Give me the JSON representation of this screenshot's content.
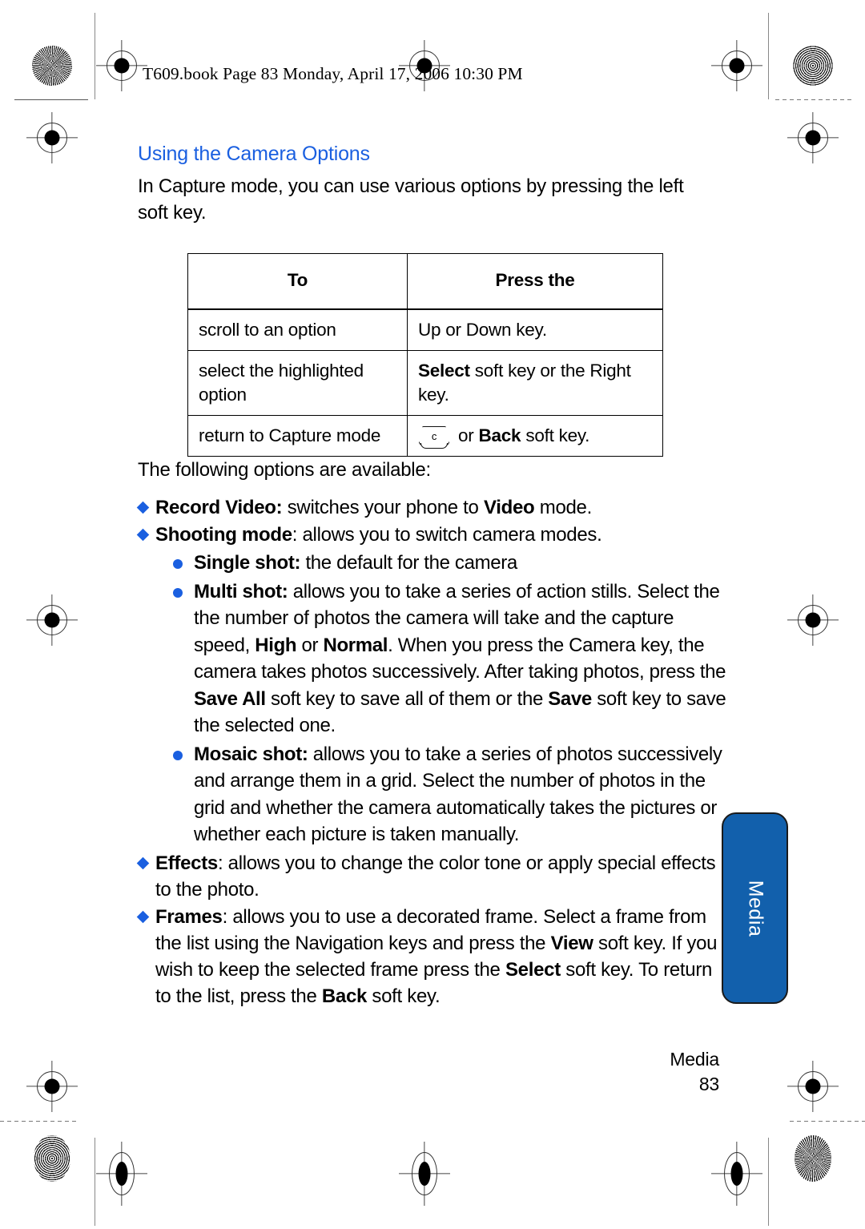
{
  "document": {
    "header_line": "T609.book  Page 83  Monday, April 17, 2006  10:30 PM",
    "section_title": "Using the Camera Options",
    "intro_paragraph": "In Capture mode, you can use various options by pressing the left soft key.",
    "after_table_paragraph": "The following options are available:"
  },
  "table": {
    "headers": [
      "To",
      "Press the"
    ],
    "rows": [
      {
        "to": "scroll to an option",
        "press_plain": "Up or Down key."
      },
      {
        "to": "select the highlighted option",
        "press_bold": "Select",
        "press_rest": " soft key or the Right key."
      },
      {
        "to": "return to Capture mode",
        "key_icon_label": "c",
        "press_mid": " or ",
        "press_bold": "Back",
        "press_rest": " soft key."
      }
    ]
  },
  "options": [
    {
      "bold": "Record Video:",
      "rest_a": " switches your phone to ",
      "bold_b": "Video",
      "rest_b": " mode."
    },
    {
      "bold": "Shooting mode",
      "rest_a": ": allows you to switch camera modes.",
      "sub": [
        {
          "bold": "Single shot:",
          "text": " the default for the camera"
        },
        {
          "bold": "Multi shot:",
          "t1": " allows you to take a series of action stills. Select the the number of photos the camera will take and the capture speed, ",
          "b2": "High",
          "t2": " or ",
          "b3": "Normal",
          "t3": ". When you press the Camera key, the camera takes photos successively. After taking photos, press the ",
          "b4": "Save All",
          "t4": " soft key to save all of them or the ",
          "b5": "Save",
          "t5": " soft key to save the selected one."
        },
        {
          "bold": "Mosaic shot:",
          "text": " allows you to take a series of photos successively and arrange them in a grid. Select the number of photos in the grid and whether the camera automatically takes the pictures or whether each picture is taken manually."
        }
      ]
    },
    {
      "bold": "Effects",
      "rest_a": ": allows you to change the color tone or apply special effects to the photo."
    },
    {
      "bold": "Frames",
      "t1": ": allows you to use a decorated frame. Select a frame from the list using the Navigation keys and press the ",
      "b2": "View",
      "t2": " soft key. If you wish to keep the selected frame press the ",
      "b3": "Select",
      "t3": " soft key. To return to the list, press the ",
      "b4": "Back",
      "t4": " soft key."
    }
  ],
  "side_tab": {
    "label": "Media"
  },
  "footer": {
    "chapter": "Media",
    "page_number": "83"
  },
  "colors": {
    "heading_blue": "#1a5fe0",
    "bullet_blue": "#1a5fe0",
    "tab_blue": "#1260ac"
  }
}
